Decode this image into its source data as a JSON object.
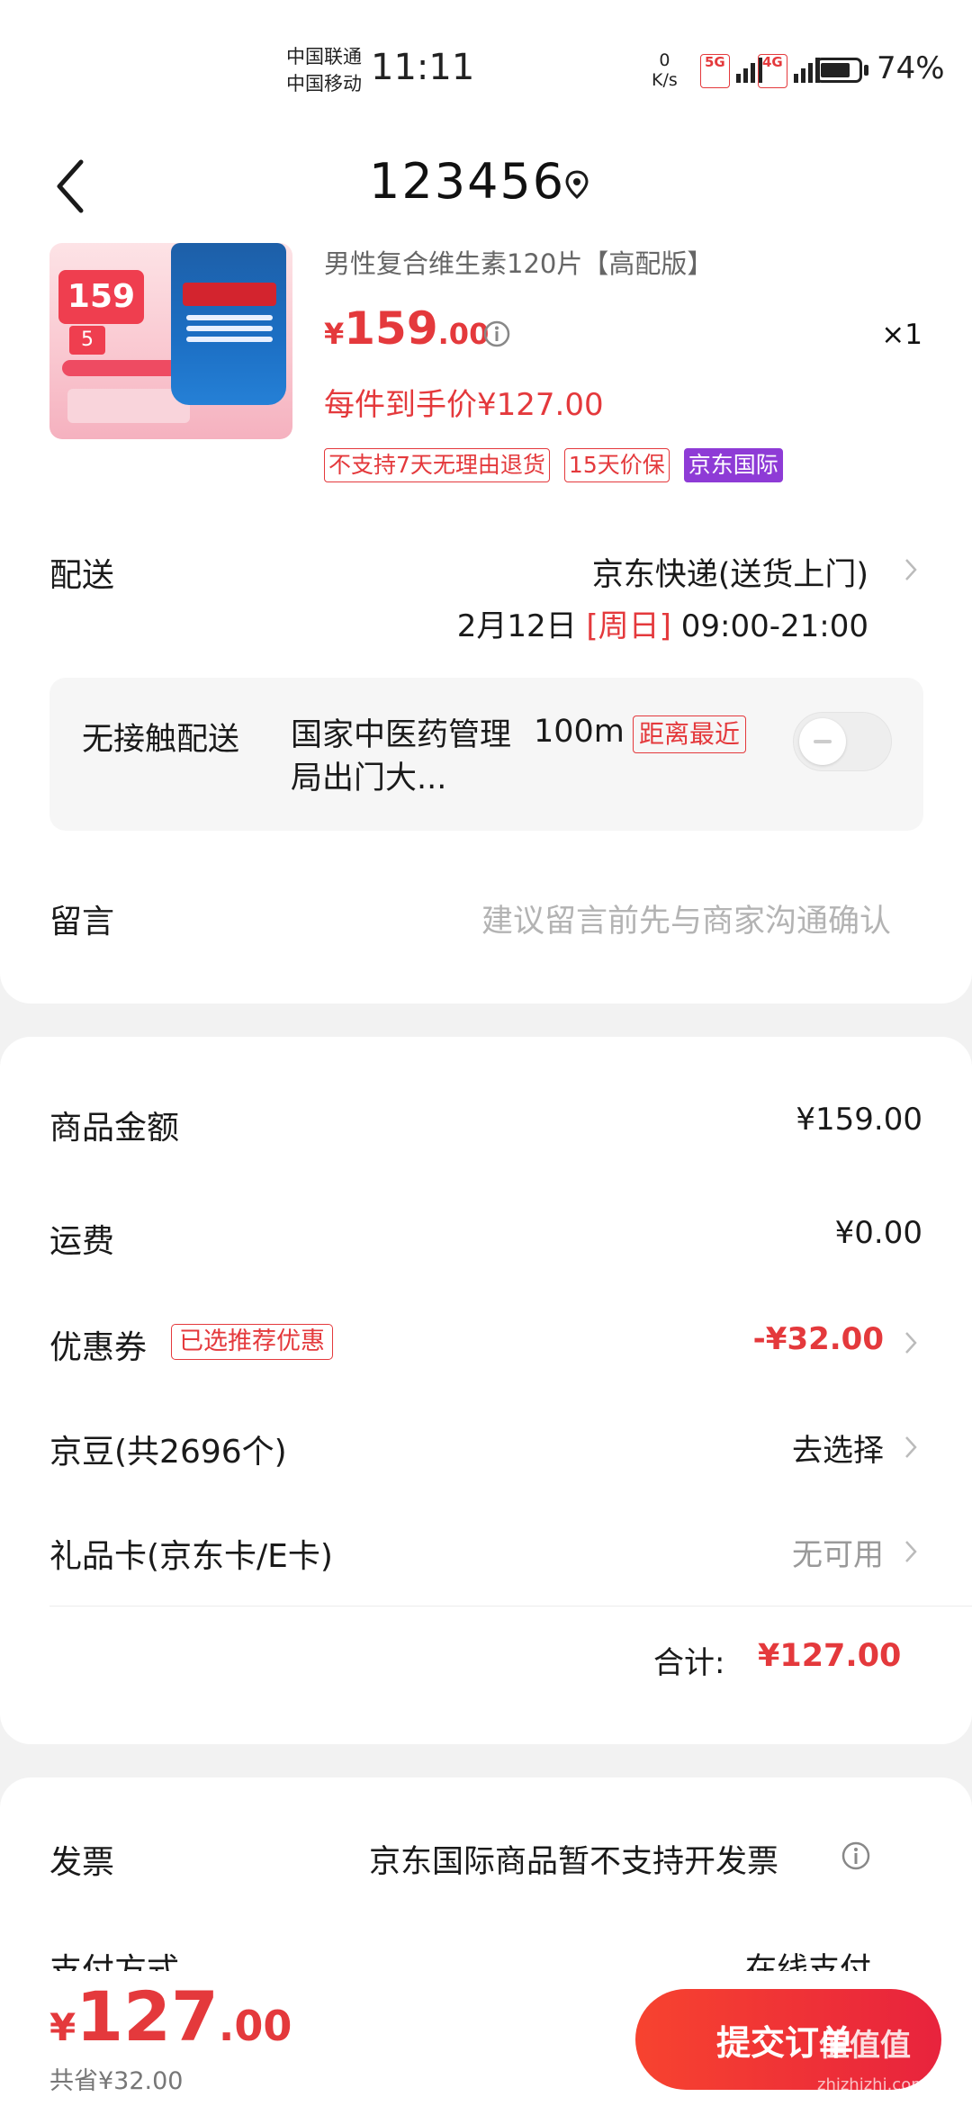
{
  "status_bar": {
    "carrier_1": "中国联通",
    "carrier_2": "中国移动",
    "time": "11:11",
    "net_speed_value": "0",
    "net_speed_unit": "K/s",
    "signal_1_tag": "5G",
    "signal_2_tag": "4G",
    "battery": "74%"
  },
  "header": {
    "title": "123456",
    "back_icon": "chevron-left-icon",
    "location_icon": "location-pin-icon"
  },
  "product": {
    "image_text": {
      "price_tag": "159",
      "coupon": "5"
    },
    "title": "男性复合维生素120片【高配版】",
    "price_yen": "¥",
    "price_int": "159",
    "price_dec": ".00",
    "quantity": "×1",
    "final_price": "每件到手价¥127.00",
    "tags": [
      "不支持7天无理由退货",
      "15天价保",
      "京东国际"
    ]
  },
  "delivery": {
    "label": "配送",
    "method": "京东快递(送货上门)",
    "date": "2月12日",
    "weekday": "[周日]",
    "time_range": "09:00-21:00"
  },
  "contactless": {
    "label": "无接触配送",
    "place": "国家中医药管理局出门大...",
    "distance": "100m",
    "nearest_badge": "距离最近",
    "toggle_on": false
  },
  "message": {
    "label": "留言",
    "placeholder": "建议留言前先与商家沟通确认"
  },
  "summary": {
    "goods_label": "商品金额",
    "goods_value": "¥159.00",
    "shipping_label": "运费",
    "shipping_value": "¥0.00",
    "coupon_label": "优惠券",
    "coupon_badge": "已选推荐优惠",
    "coupon_value": "-¥32.00",
    "beans_label": "京豆(共2696个)",
    "beans_value": "去选择",
    "giftcard_label": "礼品卡(京东卡/E卡)",
    "giftcard_value": "无可用",
    "total_label": "合计:",
    "total_value": "¥127.00"
  },
  "invoice": {
    "label": "发票",
    "text": "京东国际商品暂不支持开发票",
    "pay_label": "支付方式",
    "pay_value": "在线支付"
  },
  "bottom": {
    "yen": "¥",
    "price_int": "127",
    "price_dec": ".00",
    "saved": "共省¥32.00",
    "submit": "提交订单",
    "watermark": "值值值",
    "watermark_sub": "zhizhizhi.com"
  },
  "colors": {
    "accent_red": "#e4393c",
    "purple_tag": "#8e3bd6"
  }
}
